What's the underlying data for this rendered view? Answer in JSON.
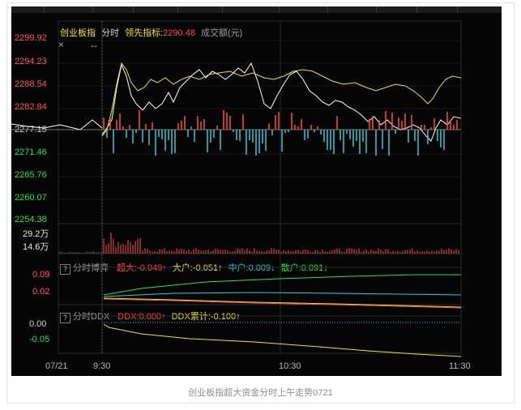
{
  "caption": "创业板指超大资金分时上午走势0721",
  "header": {
    "index_name": "创业板指",
    "mode": "分时",
    "leading_label": "领先指标:",
    "leading_value": "2290.48",
    "volume_label": "成交额(元)"
  },
  "toolbar": {
    "close_glyph": "×",
    "resize_glyph": "↔"
  },
  "price_axis": [
    "2299.92",
    "2294.23",
    "2288.54",
    "2282.84",
    "2277.15",
    "2271.46",
    "2265.76",
    "2260.07",
    "2254.38"
  ],
  "volume_axis": [
    "29.2万",
    "14.6万"
  ],
  "game_panel": {
    "q": "?",
    "title": "分时博弈",
    "items": [
      {
        "label": "超大:-0.049",
        "arrow": "↑",
        "color": "#ff4d4d"
      },
      {
        "label": "大户:-0.051",
        "arrow": "↑",
        "color": "#e8e43a"
      },
      {
        "label": "中户:0.009",
        "arrow": "↓",
        "color": "#38c8d8"
      },
      {
        "label": "散户:0.091",
        "arrow": "↓",
        "color": "#2ee04a"
      }
    ],
    "axis": [
      "0.09",
      "0.02"
    ]
  },
  "ddx_panel": {
    "q": "?",
    "title": "分时DDX",
    "items": [
      {
        "label": "DDX:0.000",
        "arrow": "↑",
        "color": "#ff4d4d"
      },
      {
        "label": "DDX累计:-0.100",
        "arrow": "↑",
        "color": "#e8e43a"
      }
    ],
    "axis": [
      "0.00",
      "-0.05"
    ]
  },
  "time_axis": [
    "07/21",
    "9:30",
    "10:30",
    "11:30"
  ],
  "colors": {
    "background": "#050505",
    "grid": "#2a2a2a",
    "price_line": "#ffffff",
    "leading_line": "#e8e43a",
    "up_bar": "#ff4d4d",
    "down_bar": "#38c8d8",
    "axis_red": "#ff5a5a",
    "axis_green": "#2ee04a"
  }
}
